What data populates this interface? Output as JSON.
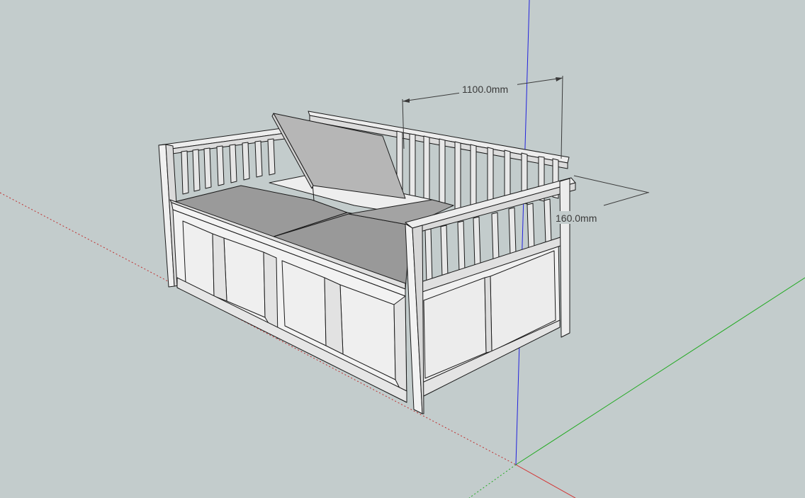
{
  "viewport": {
    "background": "#c3cccc",
    "axes": {
      "red": "#d43030",
      "green": "#22aa22",
      "blue": "#2222dd"
    }
  },
  "model": {
    "seat_color": "#9a9a9a",
    "lid_color": "#b6b6b6",
    "panel_face": "#f2f2f2",
    "panel_side": "#e2e2e2",
    "edge_color": "#1a1a1a"
  },
  "dimensions": {
    "width_label": "1100.0mm",
    "height_label": "160.0mm"
  }
}
